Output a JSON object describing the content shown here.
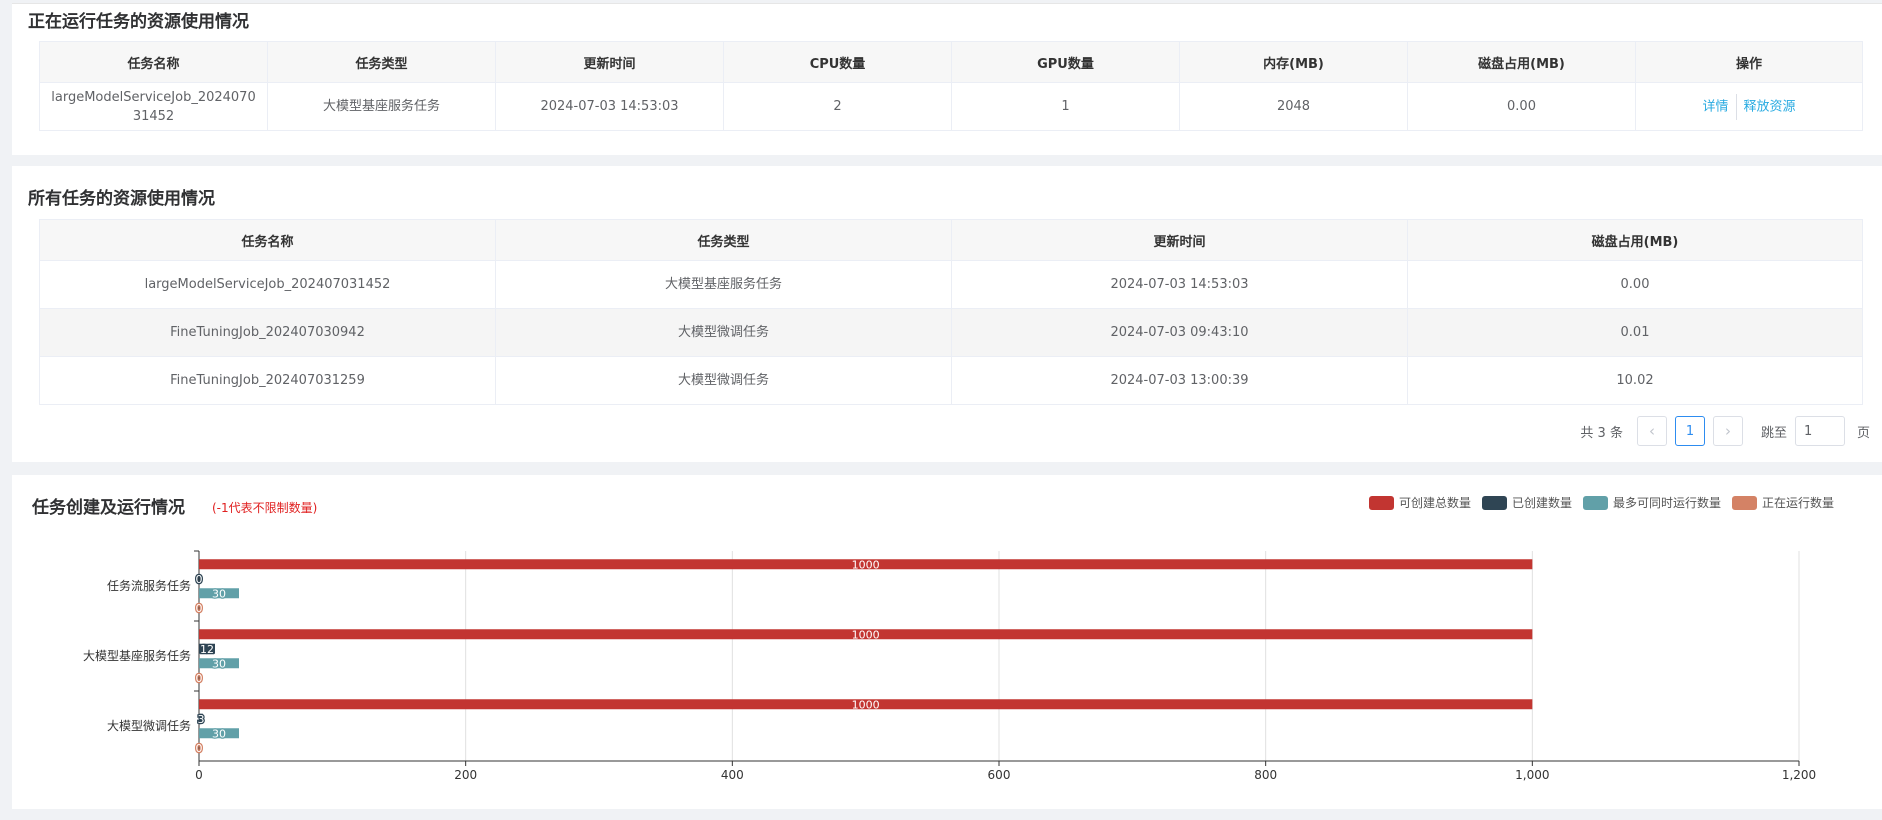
{
  "running_section": {
    "title": "正在运行任务的资源使用情况",
    "columns": [
      "任务名称",
      "任务类型",
      "更新时间",
      "CPU数量",
      "GPU数量",
      "内存(MB)",
      "磁盘占用(MB)",
      "操作"
    ],
    "rows": [
      {
        "name": "largeModelServiceJob_202407031452",
        "type": "大模型基座服务任务",
        "updated": "2024-07-03 14:53:03",
        "cpu": "2",
        "gpu": "1",
        "memory": "2048",
        "disk": "0.00",
        "detail_label": "详情",
        "release_label": "释放资源"
      }
    ]
  },
  "all_section": {
    "title": "所有任务的资源使用情况",
    "columns": [
      "任务名称",
      "任务类型",
      "更新时间",
      "磁盘占用(MB)"
    ],
    "rows": [
      {
        "name": "largeModelServiceJob_202407031452",
        "type": "大模型基座服务任务",
        "updated": "2024-07-03 14:53:03",
        "disk": "0.00"
      },
      {
        "name": "FineTuningJob_202407030942",
        "type": "大模型微调任务",
        "updated": "2024-07-03 09:43:10",
        "disk": "0.01"
      },
      {
        "name": "FineTuningJob_202407031259",
        "type": "大模型微调任务",
        "updated": "2024-07-03 13:00:39",
        "disk": "10.02"
      }
    ],
    "pagination": {
      "total": "共 3 条",
      "prev": "‹",
      "next": "›",
      "current_page": "1",
      "jump_label": "跳至",
      "jump_value": "1",
      "page_unit": "页"
    }
  },
  "chart_section": {
    "title": "任务创建及运行情况",
    "note": "(-1代表不限制数量)"
  },
  "chart_data": {
    "type": "bar",
    "orientation": "horizontal",
    "categories": [
      "任务流服务任务",
      "大模型基座服务任务",
      "大模型微调任务"
    ],
    "series": [
      {
        "name": "可创建总数量",
        "color": "#c23531",
        "values": [
          1000,
          1000,
          1000
        ]
      },
      {
        "name": "已创建数量",
        "color": "#2f4554",
        "values": [
          0,
          12,
          3
        ]
      },
      {
        "name": "最多可同时运行数量",
        "color": "#61a0a8",
        "values": [
          30,
          30,
          30
        ]
      },
      {
        "name": "正在运行数量",
        "color": "#d48265",
        "values": [
          0,
          0,
          0
        ]
      }
    ],
    "xlim": [
      0,
      1200
    ],
    "xticks": [
      0,
      200,
      400,
      600,
      800,
      1000,
      1200
    ],
    "xtick_labels": [
      "0",
      "200",
      "400",
      "600",
      "800",
      "1,000",
      "1,200"
    ],
    "grid": true,
    "legend": "top-right"
  }
}
